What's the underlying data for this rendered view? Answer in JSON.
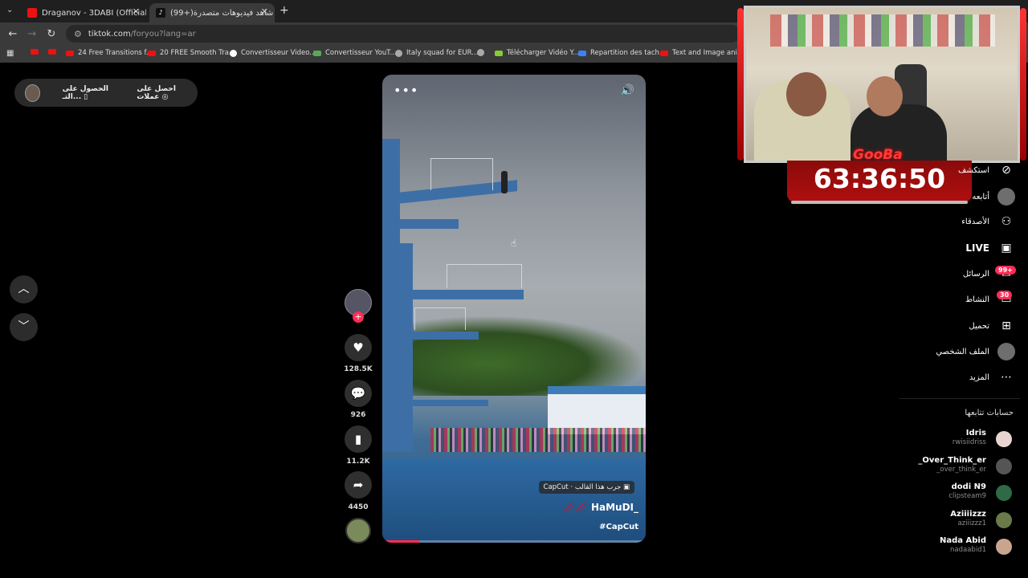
{
  "browser": {
    "tabs": [
      {
        "title": "Draganov - 3DABI (Official Mus",
        "active": false
      },
      {
        "title": "(99+)شاهد فيديوهات متصدرة | ",
        "active": true
      }
    ],
    "new_tab": "+",
    "url_host": "tiktok.com",
    "url_path": "/foryou?lang=ar",
    "bookmarks": [
      {
        "label": "",
        "icon": "youtube-icon"
      },
      {
        "label": "",
        "icon": "youtube-icon"
      },
      {
        "label": "24 Free Transitions f...",
        "icon": "youtube-icon"
      },
      {
        "label": "20 FREE Smooth Tra...",
        "icon": "youtube-icon"
      },
      {
        "label": "Convertisseur Video...",
        "icon": "google-icon"
      },
      {
        "label": "Convertisseur YouT...",
        "icon": "converter-icon"
      },
      {
        "label": "Italy squad for EUR...",
        "icon": "globe-icon"
      },
      {
        "label": "",
        "icon": "globe-icon"
      },
      {
        "label": "Télécharger Vidéo Y...",
        "icon": "download-icon"
      },
      {
        "label": "Repartition des tach...",
        "icon": "docs-icon"
      },
      {
        "label": "Text and Image ani...",
        "icon": "youtube-icon"
      }
    ]
  },
  "top_pill": {
    "get_app": "الحصول على التـ...",
    "get_coins": "احصل على عملات"
  },
  "video": {
    "template_tag": "CapCut · جرب هذا القالب",
    "author": "HaMuDI_",
    "hashtag": "#CapCut",
    "progress": 0.14
  },
  "actions": {
    "likes": "128.5K",
    "comments": "926",
    "saves": "11.2K",
    "shares": "4450"
  },
  "overlay": {
    "brand": "GooBa",
    "timer": "63:36:50"
  },
  "menu": [
    {
      "label": "استكشف",
      "icon": "compass-icon"
    },
    {
      "label": "أتابعه",
      "icon": "avatar-icon"
    },
    {
      "label": "الأصدقاء",
      "icon": "friends-icon"
    },
    {
      "label": "LIVE",
      "icon": "live-icon"
    },
    {
      "label": "الرسائل",
      "icon": "messages-icon",
      "badge": "99+"
    },
    {
      "label": "النشاط",
      "icon": "activity-icon",
      "badge": "30"
    },
    {
      "label": "تحميل",
      "icon": "upload-icon"
    },
    {
      "label": "الملف الشخصي",
      "icon": "profile-icon"
    },
    {
      "label": "المزيد",
      "icon": "more-icon"
    }
  ],
  "following": {
    "title": "حسابات تتابعها",
    "accounts": [
      {
        "name": "Idris",
        "handle": "rwisiidriss"
      },
      {
        "name": "_Over_Think_er",
        "handle": "_over_think_er"
      },
      {
        "name": "dodi N9",
        "handle": "clipsteam9"
      },
      {
        "name": "Aziiiizzz",
        "handle": "aziiizzz1"
      },
      {
        "name": "Nada Abid",
        "handle": "nadaabid1"
      }
    ]
  },
  "colors": {
    "accent": "#fe2c55",
    "timer_bg": "#b00f0f"
  }
}
